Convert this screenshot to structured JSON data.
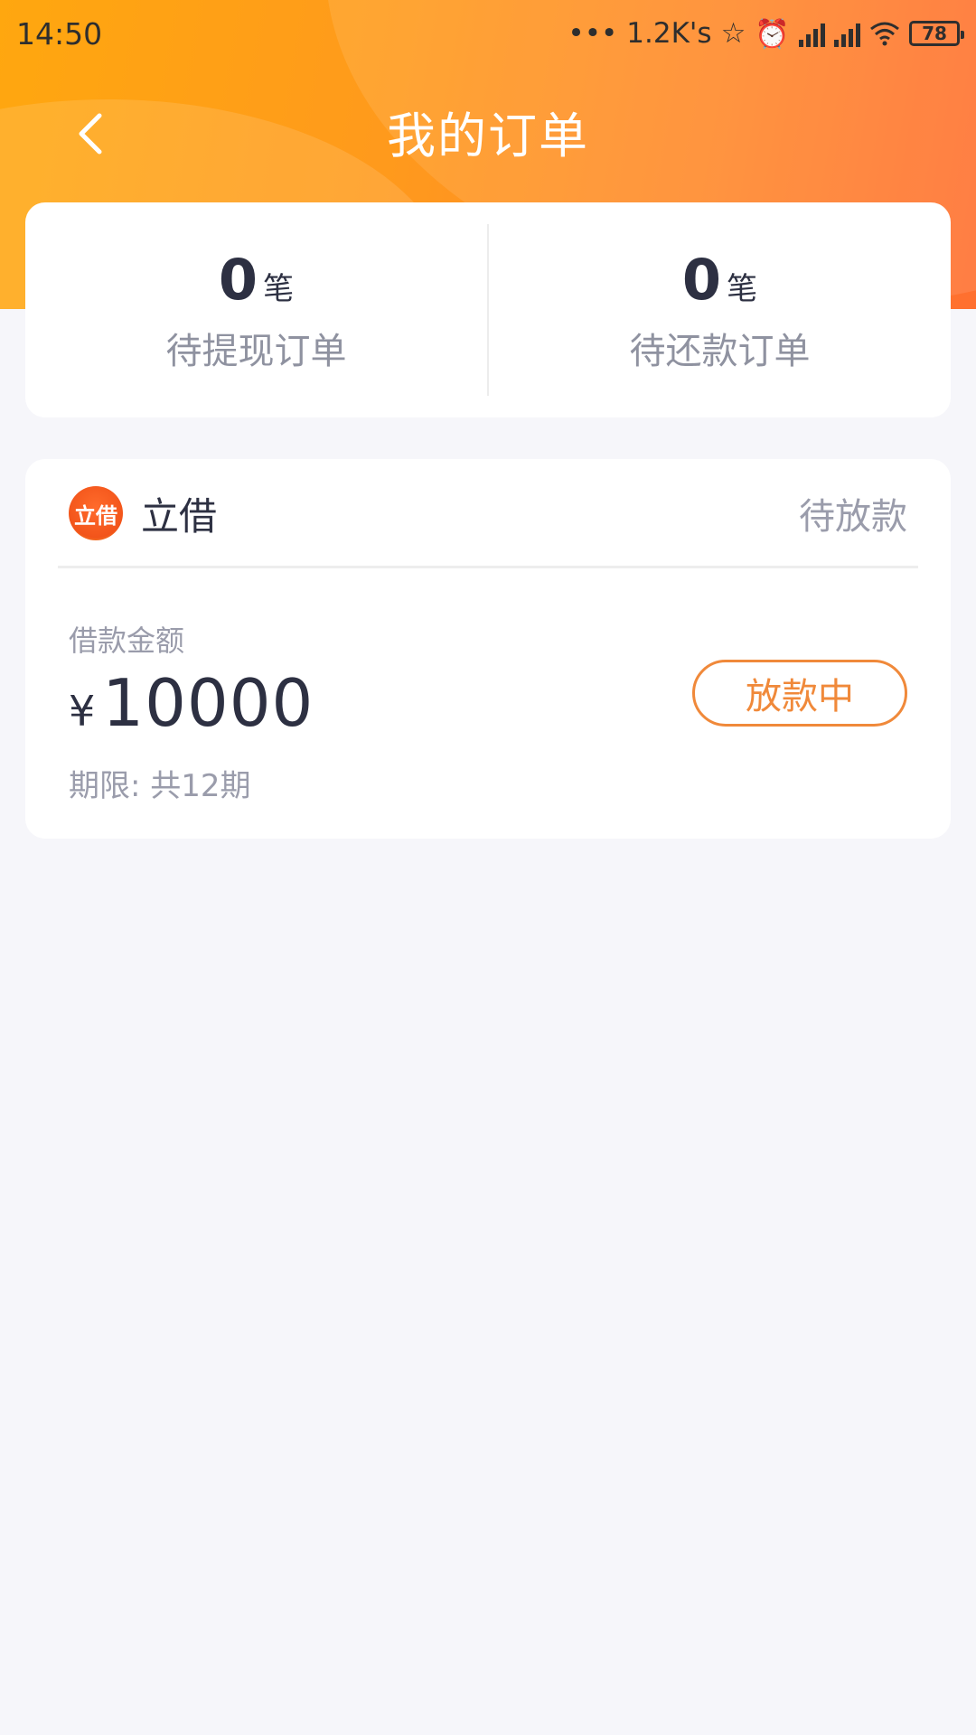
{
  "status_bar": {
    "time": "14:50",
    "network_speed": "1.2K's",
    "battery": "78",
    "icons": [
      "dots-icon",
      "star-icon",
      "alarm-icon",
      "signal-icon",
      "signal-icon",
      "wifi-icon",
      "battery-icon"
    ]
  },
  "nav": {
    "title": "我的订单",
    "back_icon": "chevron-left-icon"
  },
  "summary": [
    {
      "count": "0",
      "unit": "笔",
      "label": "待提现订单"
    },
    {
      "count": "0",
      "unit": "笔",
      "label": "待还款订单"
    }
  ],
  "order": {
    "brand": "立借",
    "logo_text": "立借",
    "status": "待放款",
    "amount_label": "借款金额",
    "currency": "¥",
    "amount": "10000",
    "term": "期限: 共12期",
    "action_label": "放款中"
  },
  "colors": {
    "header_gradient_start": "#ffa70f",
    "header_gradient_end": "#ff6f2f",
    "accent": "#f0893a",
    "text_primary": "#2d3042",
    "text_secondary": "#9a9cab",
    "background": "#f6f6fa"
  }
}
